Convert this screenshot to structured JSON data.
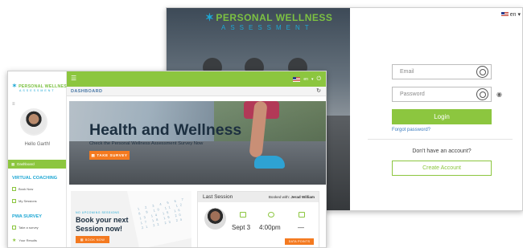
{
  "login_window": {
    "brand_line1": "PERSONAL WELLNESS",
    "brand_line2": "ASSESSMENT",
    "language": "en",
    "email_placeholder": "Email",
    "password_placeholder": "Password",
    "login_label": "Login",
    "forgot_label": "Forgot password?",
    "no_account_text": "Don't have an account?",
    "create_account_label": "Create Account",
    "colors": {
      "accent": "#8cc63f",
      "brand_blue": "#1ea7d4",
      "link": "#3b7bbf"
    }
  },
  "dashboard_window": {
    "brand_line1": "PERSONAL WELLNESS",
    "brand_line2": "ASSESSMENT",
    "greeting": "Hello Garth!",
    "sidebar": {
      "active_item": "Dashboard",
      "sections": [
        {
          "title": "VIRTUAL COACHING",
          "items": [
            "Book Now",
            "My Sessions"
          ]
        },
        {
          "title": "PWA SURVEY",
          "items": [
            "Take a survey",
            "Your Results"
          ]
        }
      ]
    },
    "topbar": {
      "language": "en"
    },
    "breadcrumb": "DASHBOARD",
    "banner": {
      "title": "Health and Wellness",
      "subtitle": "Check the Personal Wellness Assessment Survey Now",
      "button_label": "TAKE SURVEY"
    },
    "upcoming": {
      "label": "NO UPCOMING SESSIONS",
      "title": "Book your next Session now!",
      "button_label": "BOOK NOW"
    },
    "last_session": {
      "title": "Last Session",
      "booked_with_prefix": "Booked with:",
      "coach_name": "Jerad William",
      "date": "Sept 3",
      "time": "4:00pm",
      "extra": "—",
      "button_label": "DATA POINTS"
    },
    "colors": {
      "accent": "#8cc63f",
      "cta": "#f47a20",
      "brand_blue": "#1ea7d4"
    }
  }
}
